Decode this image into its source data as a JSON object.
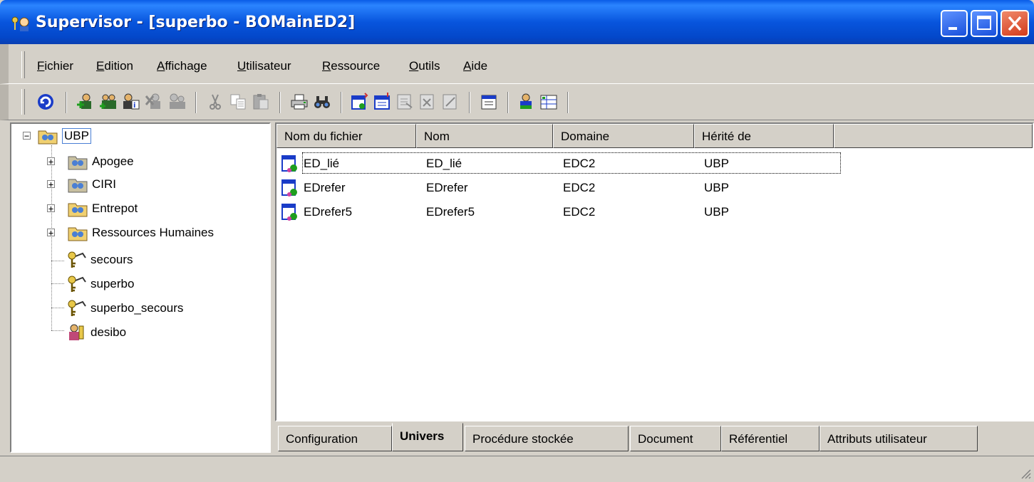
{
  "window": {
    "title": "Supervisor - [superbo - BOMainED2]",
    "app_icon": "supervisor-keys-icon",
    "accent": "#0a5ce6"
  },
  "menu": [
    "Fichier",
    "Edition",
    "Affichage",
    "Utilisateur",
    "Ressource",
    "Outils",
    "Aide"
  ],
  "toolbar": {
    "icons": [
      "refresh-icon",
      "add-user-icon",
      "add-group-icon",
      "user-properties-icon",
      "delete-user-icon",
      "user-rights-icon",
      "cut-icon",
      "copy-icon",
      "paste-icon",
      "print-icon",
      "find-icon",
      "universe-new-icon",
      "universe-import-icon",
      "universe-export-icon",
      "universe-delete-icon",
      "universe-edit-icon",
      "properties-icon",
      "user-info-icon",
      "attributes-icon"
    ]
  },
  "tree": {
    "root": "UBP",
    "items": [
      {
        "label": "Apogee",
        "type": "group",
        "expandable": true
      },
      {
        "label": "CIRI",
        "type": "group",
        "expandable": true
      },
      {
        "label": "Entrepot",
        "type": "group-open",
        "expandable": true
      },
      {
        "label": "Ressources Humaines",
        "type": "group-open",
        "expandable": true
      },
      {
        "label": "secours",
        "type": "supervisor"
      },
      {
        "label": "superbo",
        "type": "supervisor"
      },
      {
        "label": "superbo_secours",
        "type": "supervisor"
      },
      {
        "label": "desibo",
        "type": "designer"
      }
    ]
  },
  "list": {
    "columns": [
      "Nom du fichier",
      "Nom",
      "Domaine",
      "Hérité de"
    ],
    "rows": [
      {
        "file": "ED_lié",
        "name": "ED_lié",
        "domain": "EDC2",
        "inherited": "UBP"
      },
      {
        "file": "EDrefer",
        "name": "EDrefer",
        "domain": "EDC2",
        "inherited": "UBP"
      },
      {
        "file": "EDrefer5",
        "name": "EDrefer5",
        "domain": "EDC2",
        "inherited": "UBP"
      }
    ]
  },
  "tabs": [
    "Configuration",
    "Univers",
    "Procédure stockée",
    "Document",
    "Référentiel",
    "Attributs utilisateur"
  ],
  "active_tab": "Univers"
}
